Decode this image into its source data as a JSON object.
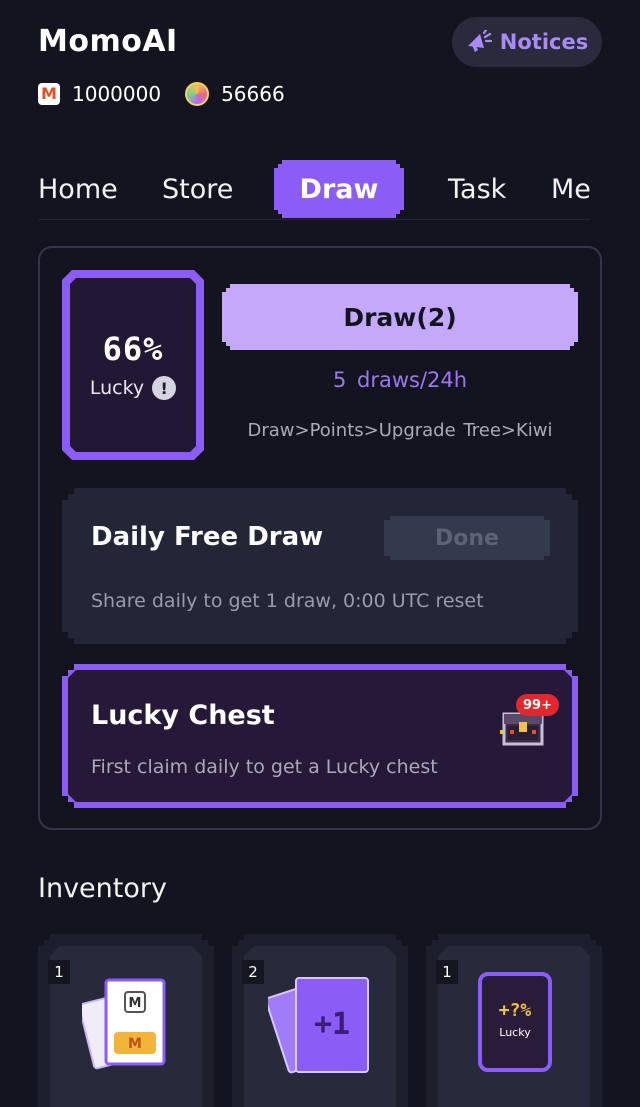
{
  "app": {
    "title": "MomoAI"
  },
  "balances": [
    {
      "icon": "momo-coin-icon",
      "value": "1000000"
    },
    {
      "icon": "kiwi-fruit-icon",
      "value": "56666"
    }
  ],
  "notices": {
    "label": "Notices",
    "icon": "megaphone-icon"
  },
  "nav": {
    "tabs": [
      "Home",
      "Store",
      "Draw",
      "Task",
      "Me"
    ],
    "active": "Draw"
  },
  "draw_panel": {
    "lucky_percent": "66%",
    "lucky_label": "Lucky",
    "draw_button": "Draw(2)",
    "draws_rate": "5 draws/24h",
    "path_hint": "Draw>Points>Upgrade Tree>Kiwi"
  },
  "daily_free_draw": {
    "title": "Daily Free Draw",
    "button": "Done",
    "description": "Share daily to get 1 draw, 0:00 UTC reset"
  },
  "lucky_chest": {
    "title": "Lucky Chest",
    "description": "First claim daily to get a Lucky chest",
    "badge": "99+"
  },
  "inventory": {
    "title": "Inventory",
    "items": [
      {
        "count": "1",
        "icon": "momo-card-icon"
      },
      {
        "count": "2",
        "icon": "plus-one-draw-card-icon",
        "card_text": "+1"
      },
      {
        "count": "1",
        "icon": "lucky-boost-card-icon",
        "card_text": "+?%",
        "card_label": "Lucky"
      }
    ]
  },
  "colors": {
    "accent": "#8b5cf6",
    "accent_light": "#c4a9fb",
    "background": "#141420",
    "badge": "#e0282d"
  }
}
